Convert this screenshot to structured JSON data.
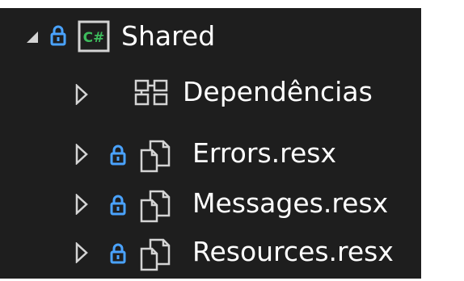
{
  "tree": {
    "root": {
      "label": "Shared",
      "expander": "expanded-triangle-icon",
      "lock": "lock-icon",
      "project_badge": "C#",
      "project_icon": "csharp-project-icon"
    },
    "items": [
      {
        "label": "Dependências",
        "expander": "collapsed-triangle-icon",
        "icon": "dependencies-icon",
        "locked": false
      },
      {
        "label": "Errors.resx",
        "expander": "collapsed-triangle-icon",
        "icon": "resx-file-icon",
        "locked": true
      },
      {
        "label": "Messages.resx",
        "expander": "collapsed-triangle-icon",
        "icon": "resx-file-icon",
        "locked": true
      },
      {
        "label": "Resources.resx",
        "expander": "collapsed-triangle-icon",
        "icon": "resx-file-icon",
        "locked": true
      }
    ],
    "colors": {
      "background": "#1e1e1e",
      "text": "#ffffff",
      "lock": "#4aa3ff",
      "csharp_badge": "#3dbb5c",
      "icon_stroke": "#d4d4d4"
    }
  }
}
